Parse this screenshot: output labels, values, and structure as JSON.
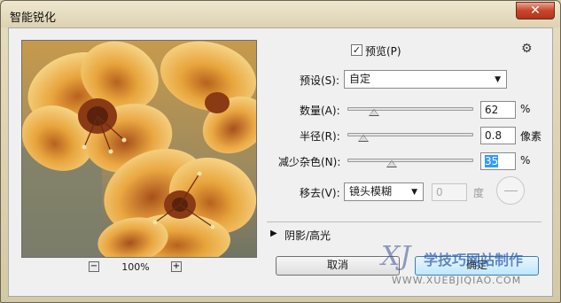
{
  "window": {
    "title": "智能锐化",
    "close_glyph": "✕"
  },
  "preview": {
    "zoom_out_glyph": "−",
    "zoom_in_glyph": "+",
    "zoom_level": "100%"
  },
  "options": {
    "preview_label": "预览(P)",
    "preview_checked": true,
    "checkbox_glyph": "✓",
    "gear_icon": "gear-icon",
    "gear_glyph": "⚙",
    "preset_label": "预设(S):",
    "preset_value": "自定",
    "dropdown_glyph": "▼"
  },
  "sliders": [
    {
      "label": "数量(A):",
      "value": "62",
      "unit": "%",
      "level": 0.21
    },
    {
      "label": "半径(R):",
      "value": "0.8",
      "unit": "像素",
      "level": 0.13
    },
    {
      "label": "减少杂色(N):",
      "value": "35",
      "unit": "%",
      "level": 0.35
    }
  ],
  "remove": {
    "label": "移去(V):",
    "value": "镜头模糊",
    "angle_value": "0",
    "angle_unit": "度"
  },
  "shadows": {
    "expand_glyph": "▶",
    "label": "阴影/高光"
  },
  "buttons": {
    "cancel": "取消",
    "ok": "确定"
  },
  "watermark": {
    "text": "学技巧网站制作",
    "url": "WWW.XUEBJIQIAO.COM"
  },
  "colors": {
    "selection": "#3399ff",
    "close": "#c7452a"
  }
}
